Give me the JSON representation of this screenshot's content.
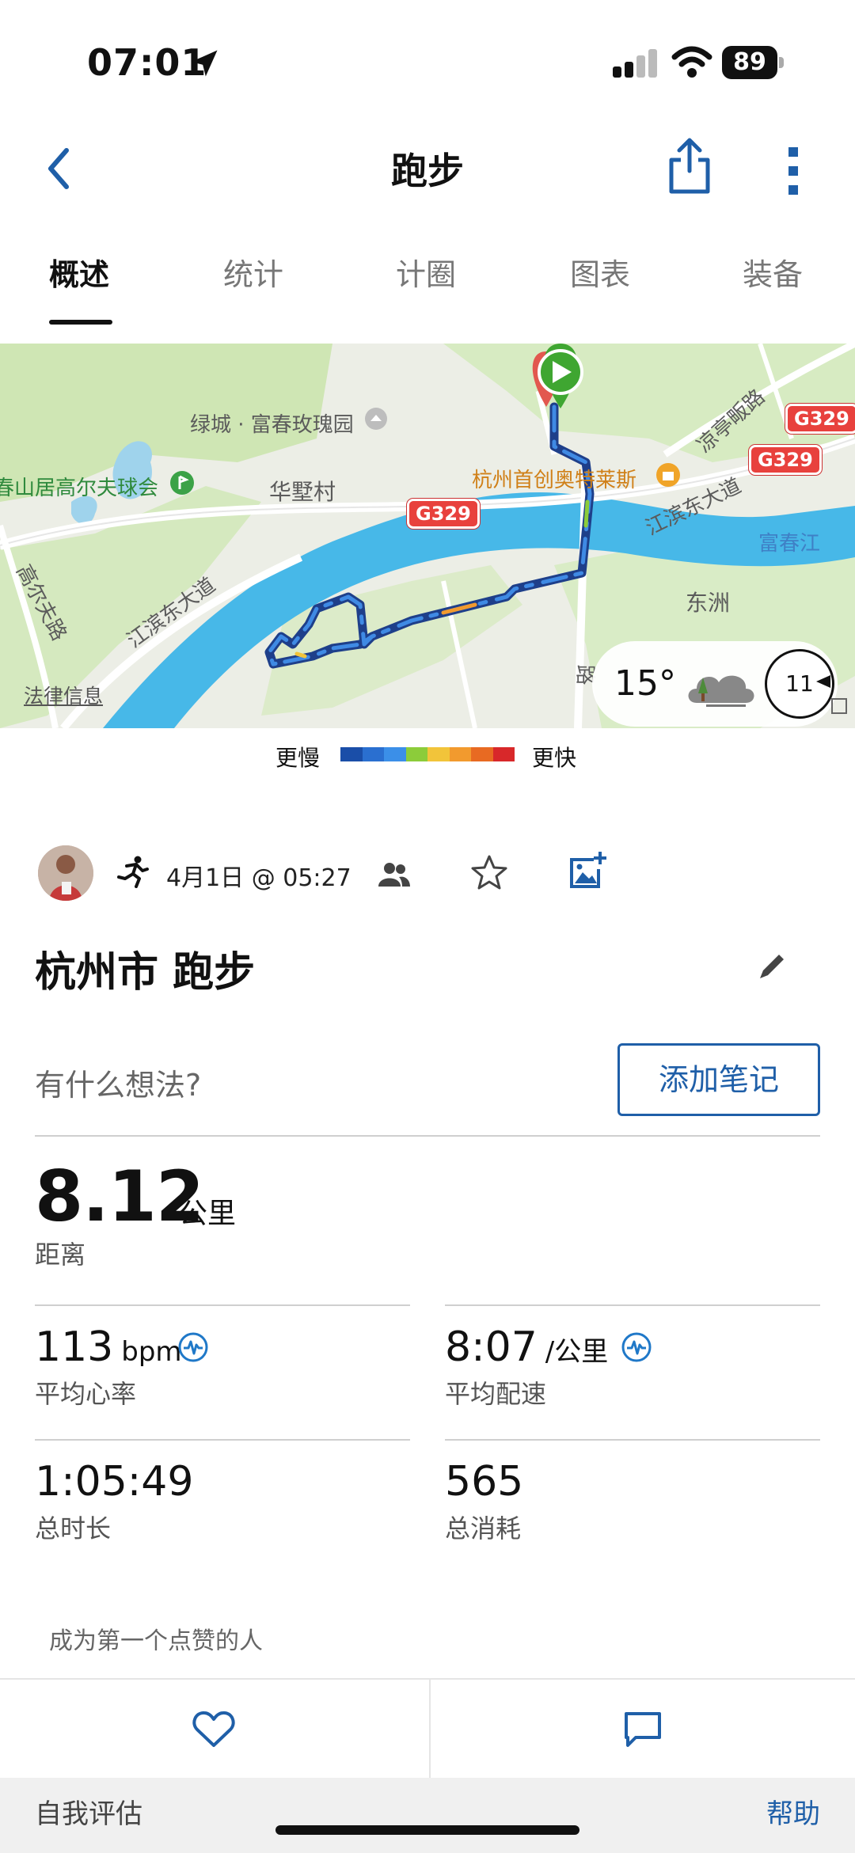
{
  "status_bar": {
    "time": "07:01",
    "battery": "89"
  },
  "header": {
    "title": "跑步"
  },
  "tabs": [
    {
      "label": "概述",
      "active": true
    },
    {
      "label": "统计",
      "active": false
    },
    {
      "label": "计圈",
      "active": false
    },
    {
      "label": "图表",
      "active": false
    },
    {
      "label": "装备",
      "active": false
    }
  ],
  "map": {
    "labels": {
      "lvcheng": "绿城 · 富春玫瑰园",
      "golf": "春山居高尔夫球会",
      "huashu": "华墅村",
      "outlets": "杭州首创奥特莱斯",
      "jiangbin_e": "江滨东大道",
      "jiangbin_w": "江滨东大道",
      "liangting": "凉亭畈路",
      "fuchun": "富春江",
      "dongzhou": "东洲",
      "gaoer": "高尔夫路",
      "road_v": "路",
      "legal": "法律信息"
    },
    "route_shields": [
      "G329",
      "G329",
      "G329"
    ],
    "weather": {
      "temp": "15°",
      "wind": "11"
    },
    "legend": {
      "slow": "更慢",
      "fast": "更快",
      "colors": [
        "#1a4ea8",
        "#2a6fd0",
        "#3b8fe8",
        "#8ccc3a",
        "#f2c43a",
        "#f29a2e",
        "#e86a22",
        "#d8282a"
      ]
    }
  },
  "activity": {
    "date": "4月1日 @ 05:27",
    "name": "杭州市 跑步",
    "thought_placeholder": "有什么想法?",
    "add_note": "添加笔记"
  },
  "stats": {
    "distance": {
      "value": "8.12",
      "unit": "公里",
      "label": "距离"
    },
    "heart_rate": {
      "value": "113",
      "unit": "bpm",
      "label": "平均心率"
    },
    "pace": {
      "value": "8:07",
      "unit": "/公里",
      "label": "平均配速"
    },
    "duration": {
      "value": "1:05:49",
      "label": "总时长"
    },
    "calories": {
      "value": "565",
      "label": "总消耗"
    }
  },
  "social": {
    "first_like": "成为第一个点赞的人"
  },
  "footer": {
    "self_eval": "自我评估",
    "help": "帮助"
  },
  "colors": {
    "accent": "#1f5fa8",
    "route": "#1e4fb0"
  }
}
